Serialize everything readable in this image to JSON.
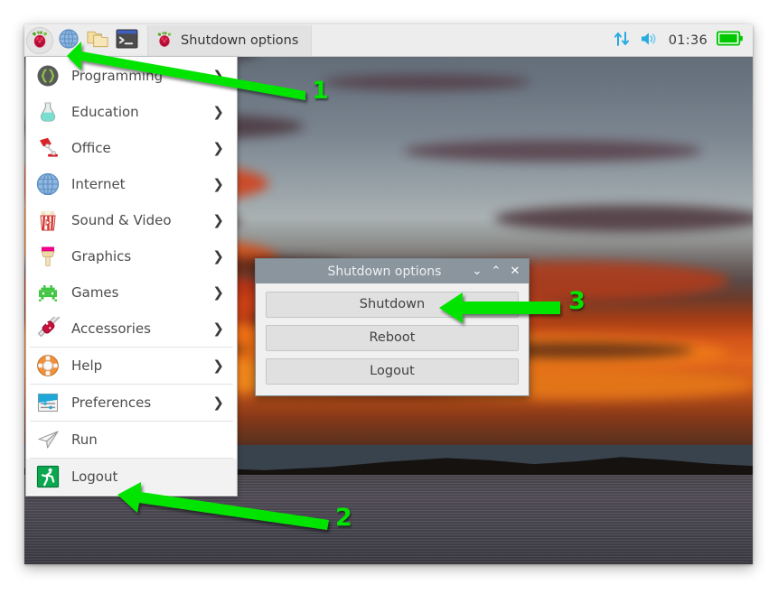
{
  "panel": {
    "launchers": [
      {
        "name": "raspberry-menu-icon",
        "label": "Menu",
        "active": true
      },
      {
        "name": "web-browser-icon",
        "label": "Web Browser",
        "active": false
      },
      {
        "name": "file-manager-icon",
        "label": "File Manager",
        "active": false
      },
      {
        "name": "terminal-icon",
        "label": "Terminal",
        "active": false
      }
    ],
    "window_button": {
      "label": "Shutdown options",
      "icon": "raspberry-icon"
    },
    "tray": {
      "network_icon": "network-updown-arrows-icon",
      "volume_icon": "speaker-volume-icon",
      "clock": "01:36",
      "battery_icon": "battery-full-icon"
    }
  },
  "appmenu": {
    "items": [
      {
        "label": "Programming",
        "icon": "braces-icon",
        "submenu": true,
        "separator_after": false,
        "highlighted": false
      },
      {
        "label": "Education",
        "icon": "flask-icon",
        "submenu": true,
        "separator_after": false,
        "highlighted": false
      },
      {
        "label": "Office",
        "icon": "desk-lamp-icon",
        "submenu": true,
        "separator_after": false,
        "highlighted": false
      },
      {
        "label": "Internet",
        "icon": "globe-icon",
        "submenu": true,
        "separator_after": false,
        "highlighted": false
      },
      {
        "label": "Sound & Video",
        "icon": "popcorn-icon",
        "submenu": true,
        "separator_after": false,
        "highlighted": false
      },
      {
        "label": "Graphics",
        "icon": "paintbrush-icon",
        "submenu": true,
        "separator_after": false,
        "highlighted": false
      },
      {
        "label": "Games",
        "icon": "space-invader-icon",
        "submenu": true,
        "separator_after": false,
        "highlighted": false
      },
      {
        "label": "Accessories",
        "icon": "swiss-knife-icon",
        "submenu": true,
        "separator_after": true,
        "highlighted": false
      },
      {
        "label": "Help",
        "icon": "life-ring-icon",
        "submenu": true,
        "separator_after": true,
        "highlighted": false
      },
      {
        "label": "Preferences",
        "icon": "sliders-icon",
        "submenu": true,
        "separator_after": true,
        "highlighted": false
      },
      {
        "label": "Run",
        "icon": "paper-plane-icon",
        "submenu": false,
        "separator_after": true,
        "highlighted": false
      },
      {
        "label": "Logout",
        "icon": "exit-running-icon",
        "submenu": false,
        "separator_after": false,
        "highlighted": true
      }
    ],
    "submenu_arrow_glyph": "❯"
  },
  "dialog": {
    "title": "Shutdown options",
    "window_buttons": [
      {
        "name": "minimize-button",
        "glyph": "⌄"
      },
      {
        "name": "maximize-button",
        "glyph": "⌃"
      },
      {
        "name": "close-button",
        "glyph": "✕"
      }
    ],
    "buttons": [
      {
        "label": "Shutdown"
      },
      {
        "label": "Reboot"
      },
      {
        "label": "Logout"
      }
    ]
  },
  "annotations": [
    {
      "number": "1",
      "target": "raspberry-menu-icon"
    },
    {
      "number": "2",
      "target": "menu-item-logout"
    },
    {
      "number": "3",
      "target": "dialog-shutdown-button"
    }
  ],
  "colors": {
    "annotation_green": "#00e400",
    "panel_background": "#ededed",
    "menu_background": "#ffffff",
    "dialog_titlebar": "#8b959e",
    "dialog_button": "#e0e0e0",
    "tray_icon_blue": "#29abe2",
    "battery_green": "#00c800"
  }
}
